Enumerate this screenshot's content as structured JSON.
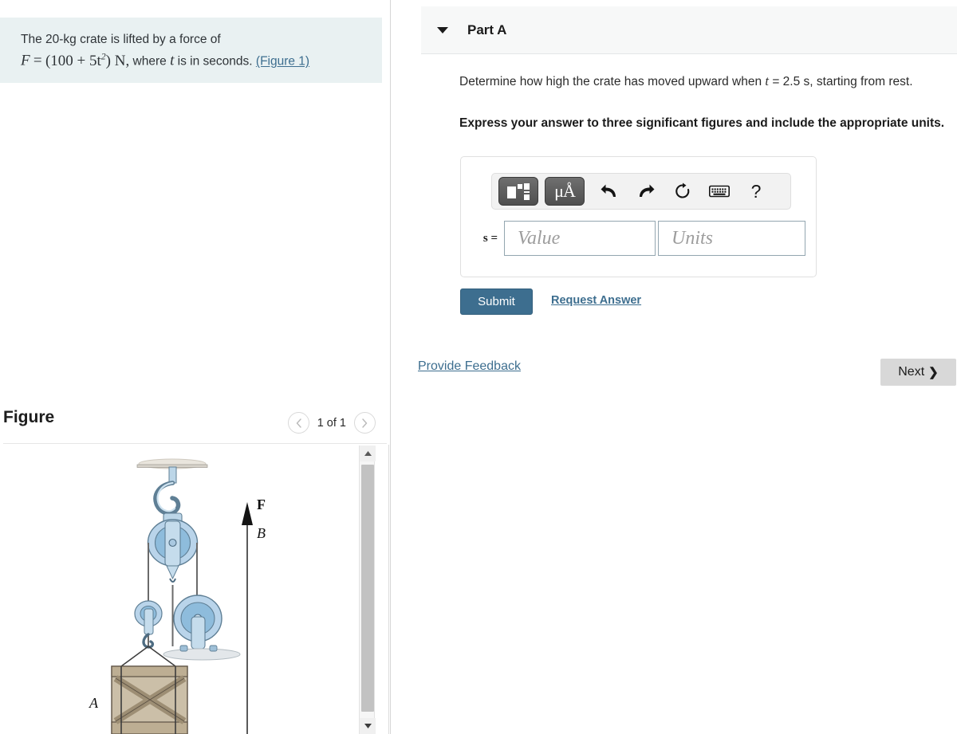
{
  "problem": {
    "line1": "The 20-kg crate is lifted by a force of",
    "formula_lhs": "F",
    "formula_eq": "=",
    "formula_body": "(100 + 5t",
    "formula_exp": "2",
    "formula_tail": ") N,",
    "formula_rest": "where",
    "formula_var": "t",
    "formula_end": "is in seconds.",
    "figure_link": "(Figure 1)"
  },
  "figure": {
    "title": "Figure",
    "prev_icon": "chevron-left-icon",
    "next_icon": "chevron-right-icon",
    "counter": "1 of 1",
    "labels": {
      "force": "F",
      "pulley_b": "B",
      "crate_a": "A"
    },
    "scrollbar": {
      "up_icon": "triangle-up-icon",
      "down_icon": "triangle-down-icon"
    }
  },
  "part": {
    "caret_icon": "caret-down-icon",
    "title": "Part A",
    "question_pre": "Determine how high the crate has moved upward when",
    "question_var": "t",
    "question_val": "= 2.5",
    "question_unit": "s",
    "question_post": ", starting from rest.",
    "instruction": "Express your answer to three significant figures and include the appropriate units."
  },
  "toolbar": {
    "template_icon": "math-template-icon",
    "units_icon": "micro-angstrom-icon",
    "units_glyph": "μÅ",
    "undo_icon": "undo-arrow-icon",
    "redo_icon": "redo-arrow-icon",
    "reset_icon": "reset-circular-arrow-icon",
    "keyboard_icon": "keyboard-icon",
    "help_icon": "help-question-icon",
    "help_glyph": "?"
  },
  "answer": {
    "label": "s =",
    "value_placeholder": "Value",
    "units_placeholder": "Units",
    "value": "",
    "units": ""
  },
  "actions": {
    "submit": "Submit",
    "request_answer": "Request Answer",
    "provide_feedback": "Provide Feedback",
    "next": "Next",
    "next_chevron": "❯"
  },
  "colors": {
    "accent_blue": "#3d6e8f",
    "problem_bg": "#e9f1f2",
    "header_bg": "#f7f8f8",
    "next_bg": "#d8d8d8"
  }
}
